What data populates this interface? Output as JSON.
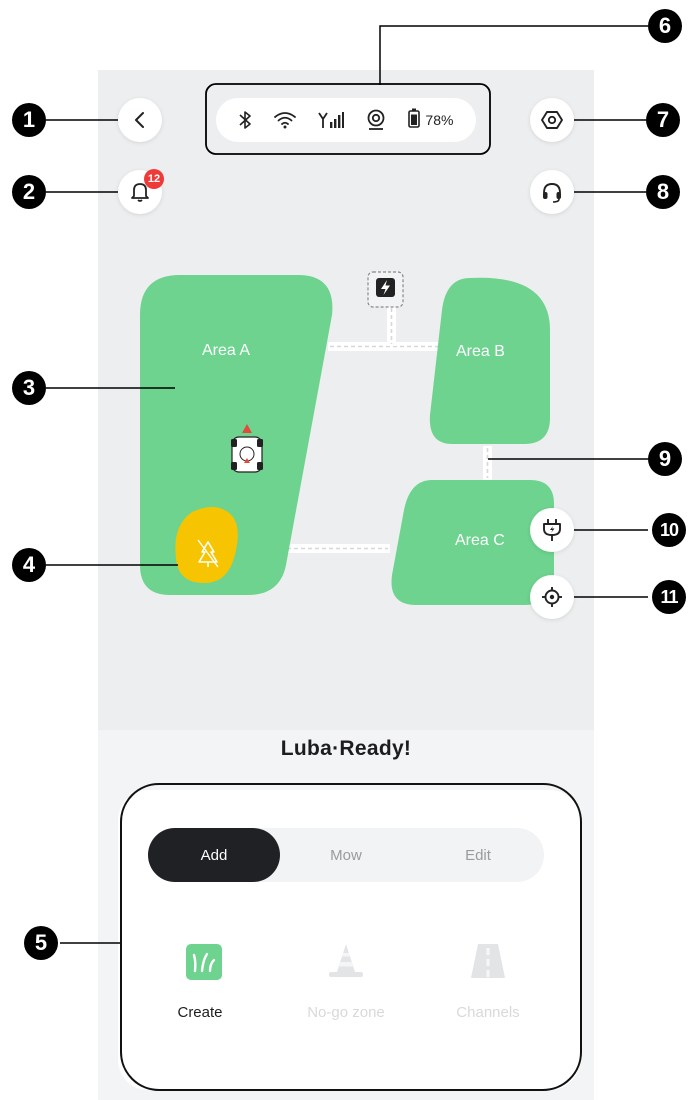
{
  "status_bar": {
    "icons": [
      "bluetooth-icon",
      "wifi-icon",
      "cellular-signal-icon",
      "gps-icon",
      "battery-icon"
    ],
    "battery_percent": "78%"
  },
  "top_buttons": {
    "back": "back-arrow-icon",
    "settings": "settings-hex-icon",
    "notifications": "bell-icon",
    "support": "headset-icon"
  },
  "notification_count": "12",
  "map": {
    "areas": [
      {
        "name": "Area A"
      },
      {
        "name": "Area B"
      },
      {
        "name": "Area C"
      }
    ],
    "colors": {
      "area": "#6dd38e",
      "path": "#ffffff",
      "nogo": "#f6c400",
      "marker": "#e24a3b"
    },
    "map_buttons": [
      "charging-plug-icon",
      "locate-target-icon"
    ]
  },
  "device_status": "Luba·Ready!",
  "mode_tabs": [
    {
      "label": "Add",
      "active": true
    },
    {
      "label": "Mow",
      "active": false
    },
    {
      "label": "Edit",
      "active": false
    }
  ],
  "tools": [
    {
      "label": "Create",
      "enabled": true,
      "icon": "grass-create-icon"
    },
    {
      "label": "No-go zone",
      "enabled": false,
      "icon": "traffic-cone-icon"
    },
    {
      "label": "Channels",
      "enabled": false,
      "icon": "road-channel-icon"
    }
  ],
  "callouts": [
    "1",
    "2",
    "3",
    "4",
    "5",
    "6",
    "7",
    "8",
    "9",
    "10",
    "11"
  ]
}
